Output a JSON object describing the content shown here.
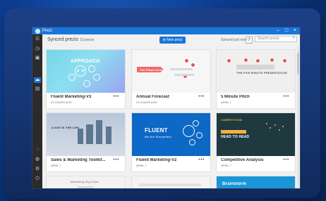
{
  "window": {
    "title": "Prezi"
  },
  "controls": {
    "minimize": "–",
    "maximize": "□",
    "close": "×"
  },
  "sidebar": {
    "icons": [
      {
        "name": "menu-icon",
        "glyph": "☰"
      },
      {
        "name": "recent-icon",
        "glyph": "◷"
      },
      {
        "name": "present-icon",
        "glyph": "▣"
      },
      {
        "name": "cloud-icon",
        "glyph": "☁"
      },
      {
        "name": "folder-icon",
        "glyph": "▤"
      },
      {
        "name": "help-icon",
        "glyph": "◌"
      },
      {
        "name": "account-icon",
        "glyph": "◍"
      },
      {
        "name": "settings-icon",
        "glyph": "⚙"
      },
      {
        "name": "power-icon",
        "glyph": "⏻"
      }
    ]
  },
  "header": {
    "title": "Synced prezis",
    "count": "13 prezis",
    "new_prezi": "New prezi",
    "sync_status": "Synced just now",
    "search_placeholder": "Search prezis",
    "search_icon": "⌕",
    "sync_icon": "⟳"
  },
  "cards": [
    {
      "title": "Fluent Marketing-V3",
      "date": "21 HOURS AGO",
      "thumb_text": "APPROACH"
    },
    {
      "title": "Annual Forecast",
      "date": "21 HOURS AGO",
      "thumb_text": "The Flash Annual"
    },
    {
      "title": "5 Minute Pitch",
      "date": "APRIL 7",
      "thumb_text": "THE FIVE MINUTE PRESENTATION"
    },
    {
      "title": "Sales & Marketing Toolkit...",
      "date": "APRIL 7",
      "thumb_text": "A DAY IN THE LIFE"
    },
    {
      "title": "Fluent Marketing-V2",
      "date": "APRIL 7",
      "thumb_text": "FLUENT"
    },
    {
      "title": "Competitive Analysis",
      "date": "APRIL 7",
      "thumb_text": "HEAD TO HEAD"
    },
    {
      "title": "Marketing Org Chart",
      "date": "",
      "thumb_text": "Marketing Org Chart"
    },
    {
      "title": "",
      "date": "",
      "thumb_text": ""
    },
    {
      "title": "Brainstorm",
      "date": "",
      "thumb_text": "Brainstorm"
    }
  ],
  "thumb_extra": {
    "fluent_subtitle": "We Are Storytellers",
    "competition_label": "COMPETITION"
  },
  "more_label": "•••",
  "colors": {
    "accent": "#1b74d8",
    "sidebar": "#2b2b2b",
    "background": "#f1f1f1"
  }
}
